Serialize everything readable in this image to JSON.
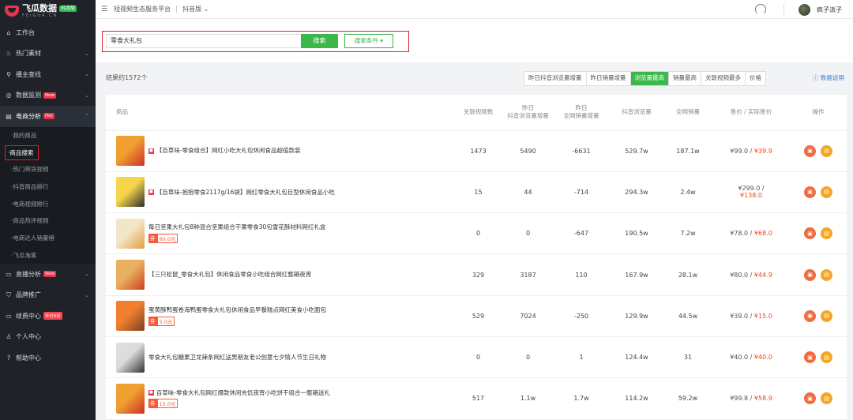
{
  "brand": {
    "name": "飞瓜数据",
    "badge": "抖音版",
    "sub": "FEIGUA.CN"
  },
  "topbar": {
    "platform": "短视频生态服务平台",
    "edition": "抖音版",
    "user": "疯子派子"
  },
  "sidebar": {
    "items": [
      {
        "icon": "home-icon",
        "glyph": "⌂",
        "label": "工作台"
      },
      {
        "icon": "fire-icon",
        "glyph": "♨",
        "label": "热门素材"
      },
      {
        "icon": "search-icon",
        "glyph": "⚲",
        "label": "播主查找"
      },
      {
        "icon": "monitor-icon",
        "glyph": "◎",
        "label": "数据监测",
        "badge": "New"
      },
      {
        "icon": "store-icon",
        "glyph": "▤",
        "label": "电商分析",
        "badge": "Hot"
      }
    ],
    "sub_items": [
      "我的商品",
      "商品搜索",
      "热门带货视频",
      "抖音商品排行",
      "电商视频排行",
      "商品热评视频",
      "电商达人销量榜",
      "飞瓜淘客"
    ],
    "bottom_items": [
      {
        "icon": "live-icon",
        "glyph": "▭",
        "label": "直播分析",
        "badge": "New"
      },
      {
        "icon": "shield-icon",
        "glyph": "⛉",
        "label": "品牌推广"
      },
      {
        "icon": "card-icon",
        "glyph": "▭",
        "label": "续费中心",
        "badge": "年付6折"
      },
      {
        "icon": "user-icon",
        "glyph": "♙",
        "label": "个人中心"
      },
      {
        "icon": "help-icon",
        "glyph": "?",
        "label": "帮助中心"
      }
    ]
  },
  "search": {
    "value": "零食大礼包",
    "button": "搜索",
    "conditions": "搜索条件"
  },
  "results": {
    "count": "结果约1572个",
    "sort": [
      "昨日抖音浏览量增量",
      "昨日销量增量",
      "浏览量最高",
      "销量最高",
      "关联视频最多",
      "价格"
    ],
    "sort_active": 2,
    "help": "数据说明"
  },
  "table": {
    "headers": [
      "商品",
      "关联视频数",
      "昨日\n抖音浏览量增量",
      "昨日\n全网销量增量",
      "抖音浏览量",
      "全网销量",
      "售价 / 实际售价",
      "操作"
    ],
    "rows": [
      {
        "title": "【百草味-零食组合】网红小吃大礼包休闲食品超值款装",
        "src": true,
        "coupon": "",
        "videos": "1473",
        "view_inc": "5490",
        "sales_inc": "-6631",
        "views": "529.7w",
        "sales": "187.1w",
        "price": "¥99.0 /",
        "actual": "¥39.9",
        "thumb": [
          "#f0a030",
          "#c8302a"
        ]
      },
      {
        "title": "【百草味-抱抱零食2117g/16袋】网红零食大礼包巨型休闲食品小吃",
        "src": true,
        "coupon": "",
        "videos": "15",
        "view_inc": "44",
        "sales_inc": "-714",
        "views": "294.3w",
        "sales": "2.4w",
        "price": "¥299.0 /",
        "actual": "¥138.0",
        "thumb": [
          "#f7d54a",
          "#2d2d2d"
        ]
      },
      {
        "title": "每日坚果大礼包8种混合坚果组合干果零食30包雪花酥材料网红礼盒",
        "src": false,
        "coupon": "60.0元",
        "videos": "0",
        "view_inc": "0",
        "sales_inc": "-647",
        "views": "190.5w",
        "sales": "7.2w",
        "price": "¥78.0 /",
        "actual": "¥68.0",
        "thumb": [
          "#f3e6c8",
          "#e0a040"
        ]
      },
      {
        "title": "【三只松鼠_零食大礼包】休闲食品零食小吃组合网红整箱夜宵",
        "src": false,
        "coupon": "",
        "videos": "329",
        "view_inc": "3187",
        "sales_inc": "110",
        "views": "167.9w",
        "sales": "28.1w",
        "price": "¥80.0 /",
        "actual": "¥44.9",
        "thumb": [
          "#e8b060",
          "#d04020"
        ]
      },
      {
        "title": "蛋黄酥鸭蛋卷海鸭蛋零食大礼包休闲食品早餐糕点网红美食小吃面包",
        "src": false,
        "coupon": "5.0元",
        "videos": "529",
        "view_inc": "7024",
        "sales_inc": "-250",
        "views": "129.9w",
        "sales": "44.5w",
        "price": "¥39.0 /",
        "actual": "¥15.0",
        "thumb": [
          "#f08030",
          "#7a4020"
        ]
      },
      {
        "title": "零食大礼包糖果卫龙辣条网红送男朋友老公创意七夕情人节生日礼物",
        "src": false,
        "coupon": "",
        "videos": "0",
        "view_inc": "0",
        "sales_inc": "1",
        "views": "124.4w",
        "sales": "31",
        "price": "¥40.0 /",
        "actual": "¥40.0",
        "thumb": [
          "#dddddd",
          "#333333"
        ]
      },
      {
        "title": "百草味-零食大礼包网红爆款休闲充饥夜宵小吃饼干组合一整箱送礼",
        "src": true,
        "coupon": "15.0元",
        "videos": "517",
        "view_inc": "1.1w",
        "sales_inc": "1.7w",
        "views": "114.2w",
        "sales": "59.2w",
        "price": "¥99.8 /",
        "actual": "¥58.9",
        "thumb": [
          "#f0a030",
          "#c8302a"
        ]
      }
    ]
  }
}
